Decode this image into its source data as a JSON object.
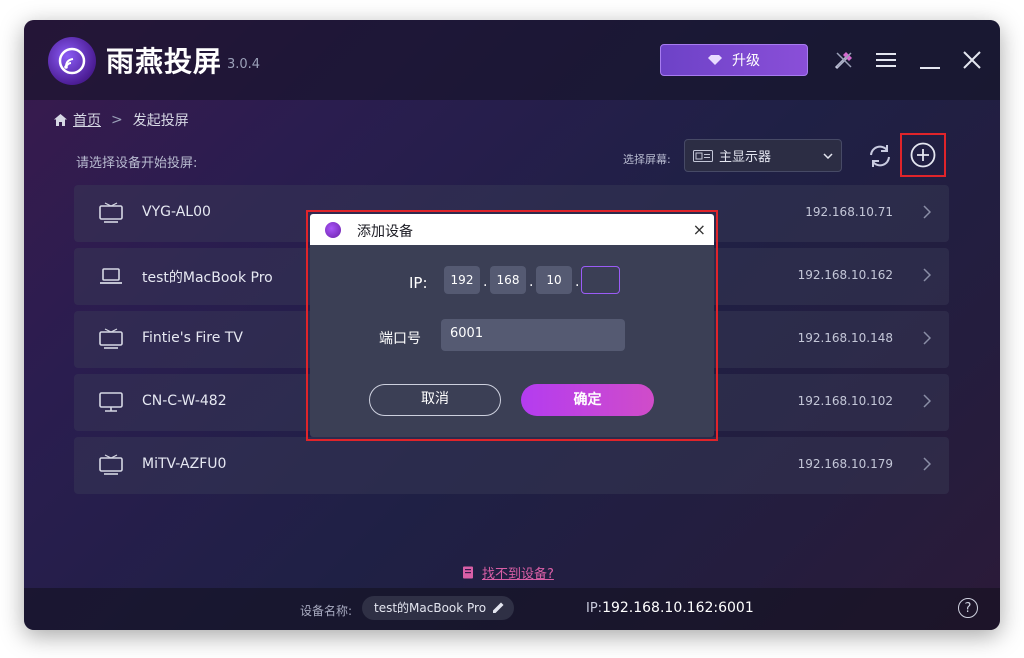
{
  "app": {
    "name": "雨燕投屏",
    "version": "3.0.4",
    "upgrade_label": "升级"
  },
  "breadcrumb": {
    "home": "首页",
    "current": "发起投屏"
  },
  "prompt": "请选择设备开始投屏:",
  "screen_select": {
    "label": "选择屏幕:",
    "value": "主显示器"
  },
  "devices": [
    {
      "name": "VYG-AL00",
      "ip": "192.168.10.71",
      "icon": "tv-icon"
    },
    {
      "name": "test的MacBook Pro",
      "ip": "192.168.10.162",
      "icon": "laptop-icon"
    },
    {
      "name": "Fintie's Fire TV",
      "ip": "192.168.10.148",
      "icon": "tv-icon"
    },
    {
      "name": "CN-C-W-482",
      "ip": "192.168.10.102",
      "icon": "monitor-icon"
    },
    {
      "name": "MiTV-AZFU0",
      "ip": "192.168.10.179",
      "icon": "tv-icon"
    }
  ],
  "not_found_link": "找不到设备?",
  "footer": {
    "device_label": "设备名称:",
    "device_name": "test的MacBook Pro",
    "ip_prefix": "IP:",
    "ip_value": "192.168.10.162:6001",
    "help": "?"
  },
  "dialog": {
    "title": "添加设备",
    "close": "×",
    "ip_label": "IP:",
    "ip_octets": [
      "192",
      "168",
      "10",
      ""
    ],
    "port_label": "端口号",
    "port_value": "6001",
    "cancel_label": "取消",
    "ok_label": "确定"
  },
  "colors": {
    "accent": "#b43cf0",
    "upgrade": "#7a48cf",
    "highlight_box": "#e0242a",
    "link": "#d95fa6"
  }
}
